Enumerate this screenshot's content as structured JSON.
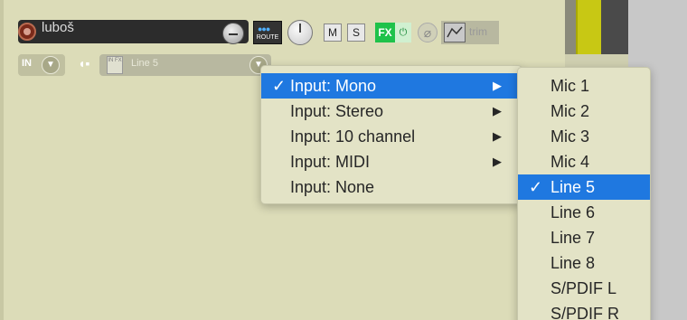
{
  "track": {
    "name": "luboš",
    "route_label": "ROUTE",
    "mute_label": "M",
    "solo_label": "S",
    "fx_label": "FX",
    "fx_power_glyph": "⏻",
    "phase_glyph": "⌀",
    "trim_label": "trim",
    "in_label": "IN",
    "infx_label": "IN FX",
    "input_value": "Line 5"
  },
  "menu": {
    "items": [
      {
        "label": "Input: Mono",
        "checked": true,
        "submenu": true
      },
      {
        "label": "Input: Stereo",
        "checked": false,
        "submenu": true
      },
      {
        "label": "Input: 10 channel",
        "checked": false,
        "submenu": true
      },
      {
        "label": "Input: MIDI",
        "checked": false,
        "submenu": true
      },
      {
        "label": "Input: None",
        "checked": false,
        "submenu": false
      }
    ],
    "check_glyph": "✓",
    "arrow_glyph": "▶"
  },
  "submenu": {
    "items": [
      "Mic 1",
      "Mic 2",
      "Mic 3",
      "Mic 4",
      "Line 5",
      "Line 6",
      "Line 7",
      "Line 8",
      "S/PDIF L",
      "S/PDIF R"
    ],
    "selected_index": 4
  },
  "colors": {
    "selection": "#1f78e0",
    "fx_green": "#1fc24a",
    "track_bg": "#dcdcb8"
  }
}
